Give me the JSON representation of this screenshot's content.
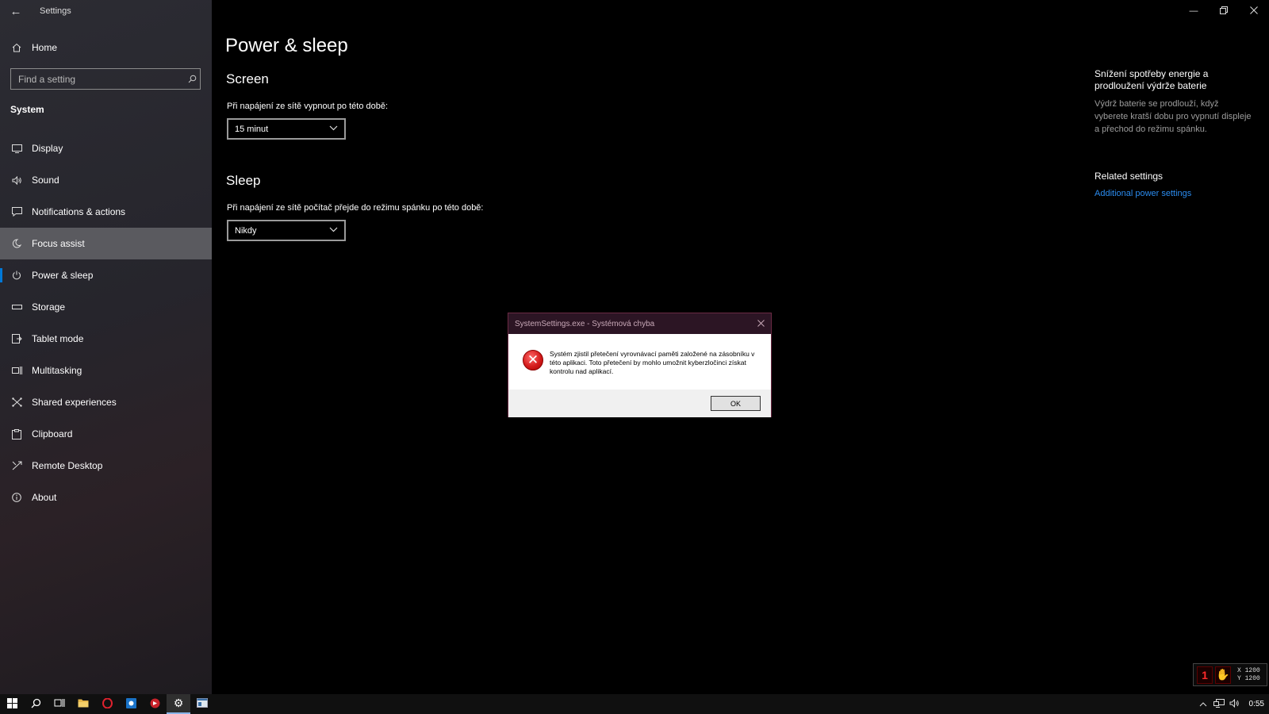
{
  "window": {
    "title": "Settings"
  },
  "sidebar": {
    "home_label": "Home",
    "search_placeholder": "Find a setting",
    "section": "System",
    "items": [
      {
        "label": "Display",
        "icon": "display-icon"
      },
      {
        "label": "Sound",
        "icon": "sound-icon"
      },
      {
        "label": "Notifications & actions",
        "icon": "notifications-icon"
      },
      {
        "label": "Focus assist",
        "icon": "focus-assist-icon"
      },
      {
        "label": "Power & sleep",
        "icon": "power-icon"
      },
      {
        "label": "Storage",
        "icon": "storage-icon"
      },
      {
        "label": "Tablet mode",
        "icon": "tablet-mode-icon"
      },
      {
        "label": "Multitasking",
        "icon": "multitasking-icon"
      },
      {
        "label": "Shared experiences",
        "icon": "shared-experiences-icon"
      },
      {
        "label": "Clipboard",
        "icon": "clipboard-icon"
      },
      {
        "label": "Remote Desktop",
        "icon": "remote-desktop-icon"
      },
      {
        "label": "About",
        "icon": "about-icon"
      }
    ],
    "hovered_item": "Focus assist",
    "selected_item": "Power & sleep",
    "accent_color": "#0078d7"
  },
  "main": {
    "page_title": "Power & sleep",
    "screen": {
      "heading": "Screen",
      "label": "Při napájení ze sítě vypnout po této době:",
      "value": "15 minut"
    },
    "sleep": {
      "heading": "Sleep",
      "label": "Při napájení ze sítě počítač přejde do režimu spánku po této době:",
      "value": "Nikdy"
    }
  },
  "side_panel": {
    "title": "Snížení spotřeby energie a prodloužení výdrže baterie",
    "description": "Výdrž baterie se prodlouží, když vyberete kratší dobu pro vypnutí displeje a přechod do režimu spánku.",
    "related_title": "Related settings",
    "related_link": "Additional power settings",
    "link_color": "#2b8cf0"
  },
  "dialog": {
    "title": "SystemSettings.exe - Systémová chyba",
    "message": "Systém zjistil přetečení vyrovnávací paměti založené na zásobníku v této aplikaci. Toto přetečení by mohlo umožnit kyberzločinci získat kontrolu nad aplikací.",
    "ok_label": "OK",
    "icon": "error-icon"
  },
  "overlay": {
    "x_label": "X 1200",
    "y_label": "Y 1200"
  },
  "taskbar": {
    "clock": "0:55",
    "apps": [
      "start-icon",
      "search-icon",
      "task-view-icon",
      "file-explorer-icon",
      "opera-icon",
      "outlook-icon",
      "app-red-icon",
      "settings-icon",
      "terminal-icon"
    ]
  }
}
